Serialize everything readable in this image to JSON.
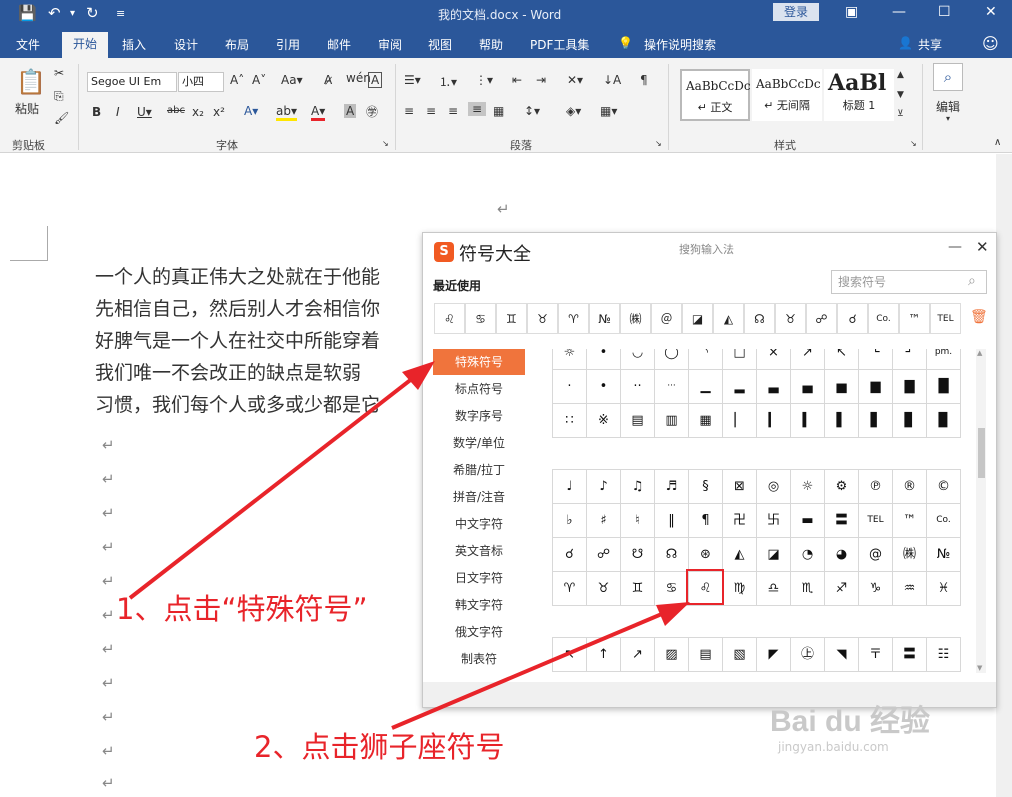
{
  "titlebar": {
    "doc_title": "我的文档.docx - Word",
    "login": "登录"
  },
  "tabs": [
    "文件",
    "开始",
    "插入",
    "设计",
    "布局",
    "引用",
    "邮件",
    "审阅",
    "视图",
    "帮助",
    "PDF工具集",
    "操作说明搜索",
    "共享"
  ],
  "ribbon": {
    "paste": "粘贴",
    "font_name": "Segoe UI Em",
    "font_size": "小四",
    "styles": [
      {
        "preview": "AaBbCcDc",
        "name": "↵ 正文"
      },
      {
        "preview": "AaBbCcDc",
        "name": "↵ 无间隔"
      },
      {
        "preview": "AaBl",
        "name": "标题 1"
      }
    ],
    "edit": "编辑",
    "groups": {
      "clipboard": "剪贴板",
      "font": "字体",
      "paragraph": "段落",
      "styles": "样式"
    }
  },
  "document": {
    "lines": [
      "一个人的真正伟大之处就在于他能",
      "先相信自己，然后别人才会相信你",
      "好脾气是一个人在社交中所能穿着",
      "我们唯一不会改正的缺点是软弱",
      "习惯，我们每个人或多或少都是它"
    ],
    "return_mark": "↵"
  },
  "panel": {
    "title": "符号大全",
    "ime": "搜狗输入法",
    "logo": "S",
    "recent_label": "最近使用",
    "search_placeholder": "搜索符号",
    "recent": [
      "♌",
      "♋",
      "♊",
      "♉",
      "♈",
      "№",
      "㈱",
      "＠",
      "◪",
      "◭",
      "☊",
      "♉",
      "☍",
      "☌",
      "Co.",
      "™",
      "TEL"
    ],
    "categories": [
      "特殊符号",
      "标点符号",
      "数字序号",
      "数学/单位",
      "希腊/拉丁",
      "拼音/注音",
      "中文字符",
      "英文音标",
      "日文字符",
      "韩文字符",
      "俄文字符",
      "制表符"
    ],
    "grid_top": [
      [
        "☼",
        "•",
        "◡",
        "◯",
        "◝",
        "□",
        "×",
        "↗",
        "↖",
        "└",
        "┘",
        "pm."
      ],
      [
        "·",
        "•",
        "··",
        "···",
        "▁",
        "▂",
        "▃",
        "▄",
        "▅",
        "▆",
        "▇",
        "█"
      ],
      [
        "∷",
        "※",
        "▤",
        "▥",
        "▦",
        "▏",
        "▎",
        "▍",
        "▌",
        "▋",
        "▊",
        "▉"
      ]
    ],
    "grid_mid": [
      [
        "♩",
        "♪",
        "♫",
        "♬",
        "§",
        "⊠",
        "◎",
        "☼",
        "⚙",
        "℗",
        "®",
        "©"
      ],
      [
        "♭",
        "♯",
        "♮",
        "‖",
        "¶",
        "卍",
        "卐",
        "▬",
        "〓",
        "TEL",
        "™",
        "Co."
      ],
      [
        "☌",
        "☍",
        "☋",
        "☊",
        "⊛",
        "◭",
        "◪",
        "◔",
        "◕",
        "@",
        "㈱",
        "№"
      ],
      [
        "♈",
        "♉",
        "♊",
        "♋",
        "♌",
        "♍",
        "♎",
        "♏",
        "♐",
        "♑",
        "♒",
        "♓"
      ]
    ],
    "grid_bottom": [
      "↖",
      "↑",
      "↗",
      "▨",
      "▤",
      "▧",
      "◤",
      "㊤",
      "◥",
      "〒",
      "〓",
      "☷"
    ]
  },
  "annotations": {
    "step1": "1、点击“特殊符号”",
    "step2": "2、点击狮子座符号"
  },
  "watermark": {
    "brand": "Bai du 经验",
    "url": "jingyan.baidu.com"
  },
  "colors": {
    "word_blue": "#2b579a",
    "accent_orange": "#f0743c",
    "annotation_red": "#e8242a"
  }
}
